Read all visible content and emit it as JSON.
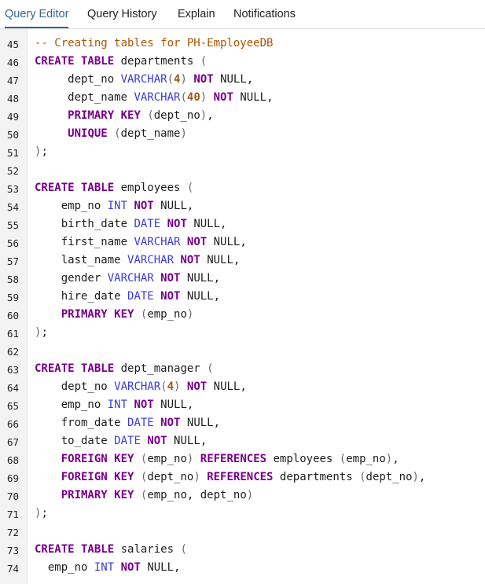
{
  "tabs": [
    {
      "label": "Query Editor",
      "active": true
    },
    {
      "label": "Query History",
      "active": false
    },
    {
      "label": "Explain",
      "active": false
    },
    {
      "label": "Notifications",
      "active": false
    }
  ],
  "colors": {
    "accent": "#326690",
    "keyword": "#770088",
    "type": "#3d3bd1",
    "comment": "#aa5500",
    "number": "#9c5a18"
  },
  "editor": {
    "lines": [
      {
        "num": "45",
        "tokens": [
          [
            "c",
            "-- Creating tables for PH-EmployeeDB"
          ]
        ]
      },
      {
        "num": "46",
        "tokens": [
          [
            "k",
            "CREATE TABLE"
          ],
          [
            "",
            " departments "
          ],
          [
            "p",
            "("
          ]
        ]
      },
      {
        "num": "47",
        "tokens": [
          [
            "",
            "     dept_no "
          ],
          [
            "t",
            "VARCHAR"
          ],
          [
            "p",
            "("
          ],
          [
            "n",
            "4"
          ],
          [
            "p",
            ")"
          ],
          [
            "",
            " "
          ],
          [
            "k",
            "NOT"
          ],
          [
            "",
            " NULL,"
          ]
        ]
      },
      {
        "num": "48",
        "tokens": [
          [
            "",
            "     dept_name "
          ],
          [
            "t",
            "VARCHAR"
          ],
          [
            "p",
            "("
          ],
          [
            "n",
            "40"
          ],
          [
            "p",
            ")"
          ],
          [
            "",
            " "
          ],
          [
            "k",
            "NOT"
          ],
          [
            "",
            " NULL,"
          ]
        ]
      },
      {
        "num": "49",
        "tokens": [
          [
            "",
            "     "
          ],
          [
            "k",
            "PRIMARY KEY"
          ],
          [
            "",
            " "
          ],
          [
            "p",
            "("
          ],
          [
            "",
            "dept_no"
          ],
          [
            "p",
            ")"
          ],
          [
            "",
            ","
          ]
        ]
      },
      {
        "num": "50",
        "tokens": [
          [
            "",
            "     "
          ],
          [
            "k",
            "UNIQUE"
          ],
          [
            "",
            " "
          ],
          [
            "p",
            "("
          ],
          [
            "",
            "dept_name"
          ],
          [
            "p",
            ")"
          ]
        ]
      },
      {
        "num": "51",
        "tokens": [
          [
            "p",
            ")"
          ],
          [
            "",
            ";"
          ]
        ]
      },
      {
        "num": "52",
        "tokens": []
      },
      {
        "num": "53",
        "tokens": [
          [
            "k",
            "CREATE TABLE"
          ],
          [
            "",
            " employees "
          ],
          [
            "p",
            "("
          ]
        ]
      },
      {
        "num": "54",
        "tokens": [
          [
            "",
            "    emp_no "
          ],
          [
            "t",
            "INT"
          ],
          [
            "",
            " "
          ],
          [
            "k",
            "NOT"
          ],
          [
            "",
            " NULL,"
          ]
        ]
      },
      {
        "num": "55",
        "tokens": [
          [
            "",
            "    birth_date "
          ],
          [
            "t",
            "DATE"
          ],
          [
            "",
            " "
          ],
          [
            "k",
            "NOT"
          ],
          [
            "",
            " NULL,"
          ]
        ]
      },
      {
        "num": "56",
        "tokens": [
          [
            "",
            "    first_name "
          ],
          [
            "t",
            "VARCHAR"
          ],
          [
            "",
            " "
          ],
          [
            "k",
            "NOT"
          ],
          [
            "",
            " NULL,"
          ]
        ]
      },
      {
        "num": "57",
        "tokens": [
          [
            "",
            "    last_name "
          ],
          [
            "t",
            "VARCHAR"
          ],
          [
            "",
            " "
          ],
          [
            "k",
            "NOT"
          ],
          [
            "",
            " NULL,"
          ]
        ]
      },
      {
        "num": "58",
        "tokens": [
          [
            "",
            "    gender "
          ],
          [
            "t",
            "VARCHAR"
          ],
          [
            "",
            " "
          ],
          [
            "k",
            "NOT"
          ],
          [
            "",
            " NULL,"
          ]
        ]
      },
      {
        "num": "59",
        "tokens": [
          [
            "",
            "    hire_date "
          ],
          [
            "t",
            "DATE"
          ],
          [
            "",
            " "
          ],
          [
            "k",
            "NOT"
          ],
          [
            "",
            " NULL,"
          ]
        ]
      },
      {
        "num": "60",
        "tokens": [
          [
            "",
            "    "
          ],
          [
            "k",
            "PRIMARY KEY"
          ],
          [
            "",
            " "
          ],
          [
            "p",
            "("
          ],
          [
            "",
            "emp_no"
          ],
          [
            "p",
            ")"
          ]
        ]
      },
      {
        "num": "61",
        "tokens": [
          [
            "p",
            ")"
          ],
          [
            "",
            ";"
          ]
        ]
      },
      {
        "num": "62",
        "tokens": []
      },
      {
        "num": "63",
        "tokens": [
          [
            "k",
            "CREATE TABLE"
          ],
          [
            "",
            " dept_manager "
          ],
          [
            "p",
            "("
          ]
        ]
      },
      {
        "num": "64",
        "tokens": [
          [
            "",
            "    dept_no "
          ],
          [
            "t",
            "VARCHAR"
          ],
          [
            "p",
            "("
          ],
          [
            "n",
            "4"
          ],
          [
            "p",
            ")"
          ],
          [
            "",
            " "
          ],
          [
            "k",
            "NOT"
          ],
          [
            "",
            " NULL,"
          ]
        ]
      },
      {
        "num": "65",
        "tokens": [
          [
            "",
            "    emp_no "
          ],
          [
            "t",
            "INT"
          ],
          [
            "",
            " "
          ],
          [
            "k",
            "NOT"
          ],
          [
            "",
            " NULL,"
          ]
        ]
      },
      {
        "num": "66",
        "tokens": [
          [
            "",
            "    from_date "
          ],
          [
            "t",
            "DATE"
          ],
          [
            "",
            " "
          ],
          [
            "k",
            "NOT"
          ],
          [
            "",
            " NULL,"
          ]
        ]
      },
      {
        "num": "67",
        "tokens": [
          [
            "",
            "    to_date "
          ],
          [
            "t",
            "DATE"
          ],
          [
            "",
            " "
          ],
          [
            "k",
            "NOT"
          ],
          [
            "",
            " NULL,"
          ]
        ]
      },
      {
        "num": "68",
        "tokens": [
          [
            "",
            "    "
          ],
          [
            "k",
            "FOREIGN KEY"
          ],
          [
            "",
            " "
          ],
          [
            "p",
            "("
          ],
          [
            "",
            "emp_no"
          ],
          [
            "p",
            ")"
          ],
          [
            "",
            " "
          ],
          [
            "k",
            "REFERENCES"
          ],
          [
            "",
            " employees "
          ],
          [
            "p",
            "("
          ],
          [
            "",
            "emp_no"
          ],
          [
            "p",
            ")"
          ],
          [
            "",
            ","
          ]
        ]
      },
      {
        "num": "69",
        "tokens": [
          [
            "",
            "    "
          ],
          [
            "k",
            "FOREIGN KEY"
          ],
          [
            "",
            " "
          ],
          [
            "p",
            "("
          ],
          [
            "",
            "dept_no"
          ],
          [
            "p",
            ")"
          ],
          [
            "",
            " "
          ],
          [
            "k",
            "REFERENCES"
          ],
          [
            "",
            " departments "
          ],
          [
            "p",
            "("
          ],
          [
            "",
            "dept_no"
          ],
          [
            "p",
            ")"
          ],
          [
            "",
            ","
          ]
        ]
      },
      {
        "num": "70",
        "tokens": [
          [
            "",
            "    "
          ],
          [
            "k",
            "PRIMARY KEY"
          ],
          [
            "",
            " "
          ],
          [
            "p",
            "("
          ],
          [
            "",
            "emp_no, dept_no"
          ],
          [
            "p",
            ")"
          ]
        ]
      },
      {
        "num": "71",
        "tokens": [
          [
            "p",
            ")"
          ],
          [
            "",
            ";"
          ]
        ]
      },
      {
        "num": "72",
        "tokens": []
      },
      {
        "num": "73",
        "tokens": [
          [
            "k",
            "CREATE TABLE"
          ],
          [
            "",
            " salaries "
          ],
          [
            "p",
            "("
          ]
        ]
      },
      {
        "num": "74",
        "tokens": [
          [
            "",
            "  emp_no "
          ],
          [
            "t",
            "INT"
          ],
          [
            "",
            " "
          ],
          [
            "k",
            "NOT"
          ],
          [
            "",
            " NULL,"
          ]
        ]
      }
    ]
  }
}
